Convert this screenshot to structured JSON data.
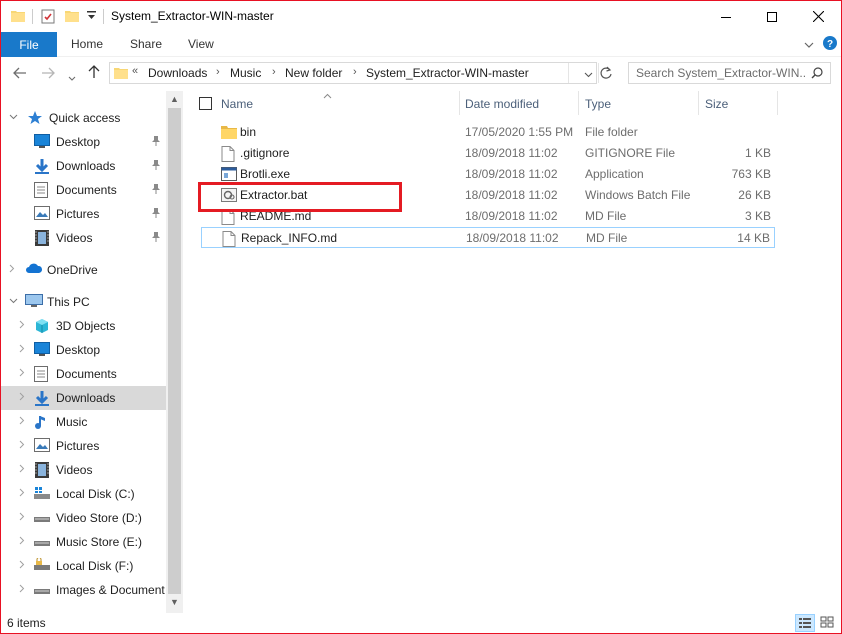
{
  "window": {
    "title": "System_Extractor-WIN-master",
    "accent": "#1979ca",
    "highlight_color": "#e41b23"
  },
  "ribbon": {
    "file_tab": "File",
    "tabs": [
      "Home",
      "Share",
      "View"
    ]
  },
  "address": {
    "overflow": "«",
    "breadcrumbs": [
      "Downloads",
      "Music",
      "New folder",
      "System_Extractor-WIN-master"
    ]
  },
  "search": {
    "placeholder": "Search System_Extractor-WIN..."
  },
  "columns": {
    "name": "Name",
    "date": "Date modified",
    "type": "Type",
    "size": "Size"
  },
  "files": [
    {
      "name": "bin",
      "date": "17/05/2020 1:55 PM",
      "type": "File folder",
      "size": "",
      "icon": "folder-icon"
    },
    {
      "name": ".gitignore",
      "date": "18/09/2018 11:02",
      "type": "GITIGNORE File",
      "size": "1 KB",
      "icon": "file-icon"
    },
    {
      "name": "Brotli.exe",
      "date": "18/09/2018 11:02",
      "type": "Application",
      "size": "763 KB",
      "icon": "exe-icon"
    },
    {
      "name": "Extractor.bat",
      "date": "18/09/2018 11:02",
      "type": "Windows Batch File",
      "size": "26 KB",
      "icon": "batch-file-icon"
    },
    {
      "name": "README.md",
      "date": "18/09/2018 11:02",
      "type": "MD File",
      "size": "3 KB",
      "icon": "file-icon"
    },
    {
      "name": "Repack_INFO.md",
      "date": "18/09/2018 11:02",
      "type": "MD File",
      "size": "14 KB",
      "icon": "file-icon"
    }
  ],
  "sidebar": {
    "quick_access": {
      "label": "Quick access",
      "items": [
        {
          "label": "Desktop",
          "icon": "desktop-icon"
        },
        {
          "label": "Downloads",
          "icon": "downloads-icon"
        },
        {
          "label": "Documents",
          "icon": "documents-icon"
        },
        {
          "label": "Pictures",
          "icon": "pictures-icon"
        },
        {
          "label": "Videos",
          "icon": "videos-icon"
        }
      ]
    },
    "onedrive": "OneDrive",
    "this_pc": {
      "label": "This PC",
      "items": [
        {
          "label": "3D Objects",
          "icon": "3d-objects-icon"
        },
        {
          "label": "Desktop",
          "icon": "desktop-icon"
        },
        {
          "label": "Documents",
          "icon": "documents-icon"
        },
        {
          "label": "Downloads",
          "icon": "downloads-icon",
          "selected": true
        },
        {
          "label": "Music",
          "icon": "music-icon"
        },
        {
          "label": "Pictures",
          "icon": "pictures-icon"
        },
        {
          "label": "Videos",
          "icon": "videos-icon"
        },
        {
          "label": "Local Disk (C:)",
          "icon": "windows-drive-icon"
        },
        {
          "label": "Video Store (D:)",
          "icon": "drive-icon"
        },
        {
          "label": "Music Store (E:)",
          "icon": "drive-icon"
        },
        {
          "label": "Local Disk (F:)",
          "icon": "locked-drive-icon"
        },
        {
          "label": "Images & Document",
          "icon": "drive-icon"
        }
      ]
    }
  },
  "status": {
    "item_count": "6 items"
  }
}
